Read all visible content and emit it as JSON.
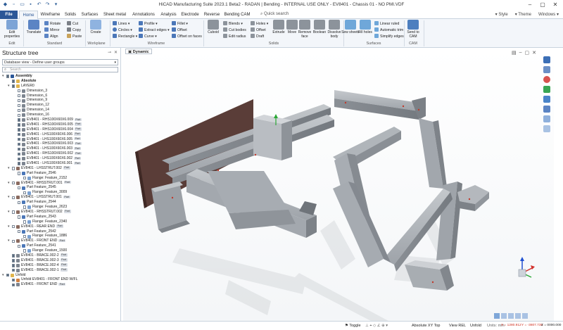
{
  "app": {
    "title": "HiCAD Manufacturing Suite 2023.1 Beta2 - RADAN | Bending - INTERNAL USE ONLY - EV8401 - Chassis 01 - NO PMI.VDF"
  },
  "menu": {
    "tabs": [
      "File",
      "Home",
      "Wireframe",
      "Solids",
      "Surfaces",
      "Sheet metal",
      "Annotations",
      "Analysis",
      "Electrode",
      "Reverse",
      "Bending CAM"
    ],
    "active_tab": "Home",
    "search_placeholder": "Quick search",
    "right": [
      "Style",
      "Theme",
      "Windows"
    ]
  },
  "ribbon": {
    "edit": {
      "label": "Edit",
      "edit_properties": "Edit properties"
    },
    "standard": {
      "label": "Standard",
      "translate": "Translate",
      "rotate": "Rotate",
      "mirror": "Mirror",
      "align": "Align",
      "cut": "Cut",
      "copy": "Copy",
      "paste": "Paste"
    },
    "workplane": {
      "label": "Workplane",
      "create": "Create"
    },
    "wireframe": {
      "label": "Wireframe",
      "lines": "Lines",
      "circles": "Circles",
      "rectangle": "Rectangle",
      "profile": "Profile",
      "extract_edges": "Extract edges",
      "curve": "Curve",
      "fillet": "Fillet",
      "offset": "Offset",
      "offset_on_faces": "Offset on faces"
    },
    "solids": {
      "label": "Solids",
      "cuboid": "Cuboid",
      "blends": "Blends",
      "cut_bodies": "Cut bodies",
      "edit_radius": "Edit radius",
      "holes": "Holes",
      "offset": "Offset",
      "draft": "Draft",
      "extrude": "Extrude",
      "move": "Move",
      "remove_face": "Remove face",
      "boolean": "Boolean",
      "dissolve_body": "Dissolve body"
    },
    "surfaces": {
      "label": "Surfaces",
      "sew_sheets": "Sew sheets",
      "fill_holes": "Fill holes",
      "linear_ruled": "Linear ruled",
      "automatic_trim": "Automatic trim",
      "simplify_edges": "Simplify edges"
    },
    "cam": {
      "label": "CAM",
      "send_to_cam": "Send to CAM"
    }
  },
  "tree": {
    "title": "Structure tree",
    "view_select": "Database view - Define user groups",
    "search_placeholder": "Search",
    "rows": [
      {
        "indent": 0,
        "exp": "▾",
        "check": true,
        "icon": "assembly",
        "label": "Assembly",
        "bold": true
      },
      {
        "indent": 1,
        "exp": "",
        "check": true,
        "icon": "folder",
        "label": "Absolute",
        "bold": true
      },
      {
        "indent": 1,
        "exp": "▾",
        "check": true,
        "icon": "folder",
        "label": "LAYER0"
      },
      {
        "indent": 2,
        "exp": "",
        "check": false,
        "icon": "part",
        "label": "Dimension_3"
      },
      {
        "indent": 2,
        "exp": "",
        "check": false,
        "icon": "part",
        "label": "Dimension_6"
      },
      {
        "indent": 2,
        "exp": "",
        "check": false,
        "icon": "part",
        "label": "Dimension_9"
      },
      {
        "indent": 2,
        "exp": "",
        "check": false,
        "icon": "part",
        "label": "Dimension_12"
      },
      {
        "indent": 2,
        "exp": "",
        "check": false,
        "icon": "part",
        "label": "Dimension_14"
      },
      {
        "indent": 2,
        "exp": "",
        "check": false,
        "icon": "part",
        "label": "Dimension_16"
      },
      {
        "indent": 2,
        "exp": "",
        "check": true,
        "icon": "part",
        "label": "EV8401 - RHS100X60X6.009",
        "badge": "Part"
      },
      {
        "indent": 2,
        "exp": "",
        "check": true,
        "icon": "part",
        "label": "EV8401 - RHS100X60X6.005",
        "badge": "Part"
      },
      {
        "indent": 2,
        "exp": "",
        "check": true,
        "icon": "part",
        "label": "EV8401 - RHS100X60X6.004",
        "badge": "Part"
      },
      {
        "indent": 2,
        "exp": "",
        "check": true,
        "icon": "part",
        "label": "EV8401 - LHS100X60X6.006",
        "badge": "Part"
      },
      {
        "indent": 2,
        "exp": "",
        "check": true,
        "icon": "part",
        "label": "EV8401 - LHS100X60X6.005",
        "badge": "Part"
      },
      {
        "indent": 2,
        "exp": "",
        "check": true,
        "icon": "part",
        "label": "EV8401 - RHS100X60X6.003",
        "badge": "Part"
      },
      {
        "indent": 2,
        "exp": "",
        "check": true,
        "icon": "part",
        "label": "EV8401 - LHS100X60X6.003",
        "badge": "Part"
      },
      {
        "indent": 2,
        "exp": "",
        "check": true,
        "icon": "part",
        "label": "EV8401 - RHS100X60X6.002",
        "badge": "Part"
      },
      {
        "indent": 2,
        "exp": "",
        "check": true,
        "icon": "part",
        "label": "EV8401 - LHS100X60X6.002",
        "badge": "Part"
      },
      {
        "indent": 2,
        "exp": "",
        "check": true,
        "icon": "part",
        "label": "EV8401 - LHS100X60X6.001",
        "badge": "Part"
      },
      {
        "indent": 1,
        "exp": "▾",
        "check": false,
        "icon": "sheet",
        "label": "EV8401 - LHSSTRUT.002",
        "badge": "Part"
      },
      {
        "indent": 2,
        "exp": "",
        "check": false,
        "icon": "feature",
        "label": "Part Feature_2546"
      },
      {
        "indent": 3,
        "exp": "",
        "check": false,
        "icon": "flange",
        "label": "Flange: Feature_2152"
      },
      {
        "indent": 1,
        "exp": "▾",
        "check": false,
        "icon": "sheet",
        "label": "EV8401 - RHSSTRUT.001",
        "badge": "Part"
      },
      {
        "indent": 2,
        "exp": "",
        "check": false,
        "icon": "feature",
        "label": "Part Feature_2545"
      },
      {
        "indent": 3,
        "exp": "",
        "check": false,
        "icon": "flange",
        "label": "Flange: Feature_3009"
      },
      {
        "indent": 1,
        "exp": "▾",
        "check": false,
        "icon": "sheet",
        "label": "EV8401 - LHSSTRUT.001",
        "badge": "Part"
      },
      {
        "indent": 2,
        "exp": "",
        "check": false,
        "icon": "feature",
        "label": "Part Feature_2544"
      },
      {
        "indent": 3,
        "exp": "",
        "check": false,
        "icon": "flange",
        "label": "Flange: Feature_2623"
      },
      {
        "indent": 1,
        "exp": "▾",
        "check": false,
        "icon": "sheet",
        "label": "EV8401 - RHSSTRUT.002",
        "badge": "Part"
      },
      {
        "indent": 2,
        "exp": "",
        "check": false,
        "icon": "feature",
        "label": "Part Feature_2543"
      },
      {
        "indent": 3,
        "exp": "",
        "check": false,
        "icon": "flange",
        "label": "Flange: Feature_2340"
      },
      {
        "indent": 1,
        "exp": "▾",
        "check": false,
        "icon": "sheet",
        "label": "EV8401 - REAR END",
        "badge": "Part"
      },
      {
        "indent": 2,
        "exp": "",
        "check": false,
        "icon": "feature",
        "label": "Part Feature_2542"
      },
      {
        "indent": 3,
        "exp": "",
        "check": false,
        "icon": "flange",
        "label": "Flange: Feature_1886"
      },
      {
        "indent": 1,
        "exp": "▾",
        "check": false,
        "icon": "sheet",
        "label": "EV8401 - FRONT END",
        "badge": "Part"
      },
      {
        "indent": 2,
        "exp": "",
        "check": false,
        "icon": "feature",
        "label": "Part Feature_2541"
      },
      {
        "indent": 3,
        "exp": "",
        "check": false,
        "icon": "flange",
        "label": "Flange: Feature_1500"
      },
      {
        "indent": 1,
        "exp": "",
        "check": true,
        "icon": "part",
        "label": "EV8401 - BRACE.002-2",
        "badge": "Part"
      },
      {
        "indent": 1,
        "exp": "",
        "check": true,
        "icon": "part",
        "label": "EV8401 - BRACE.002-3",
        "badge": "Part"
      },
      {
        "indent": 1,
        "exp": "",
        "check": true,
        "icon": "part",
        "label": "EV8401 - BRACE.002-4",
        "badge": "Part"
      },
      {
        "indent": 1,
        "exp": "",
        "check": true,
        "icon": "part",
        "label": "EV8401 - BRACE.002-1",
        "badge": "Part"
      },
      {
        "indent": 0,
        "exp": "▾",
        "check": true,
        "icon": "folder",
        "label": "Unfold"
      },
      {
        "indent": 1,
        "exp": "",
        "check": true,
        "icon": "unfold",
        "label": "Unfold EV8401 - FRONT END W/FL"
      },
      {
        "indent": 1,
        "exp": "",
        "check": true,
        "icon": "part",
        "label": "EV8401 - FRONT END",
        "badge": "Part"
      }
    ]
  },
  "viewport": {
    "tab_label": "Dynamic"
  },
  "status": {
    "toggle": "Toggle",
    "absolute_view": "Absolute XY Top",
    "view_rel": "View REL",
    "unfold": "Unfold",
    "units": "Units: mm",
    "x": "X = 1280.912",
    "y": "Y = -3807.735",
    "z": "Z = 0000.000"
  },
  "colors": {
    "accent": "#2b5797",
    "steel": "#a9adb2",
    "plate": "#5a3d38",
    "axis_x": "#d2322d",
    "axis_y": "#2aa835",
    "axis_z": "#1f4fd1"
  }
}
